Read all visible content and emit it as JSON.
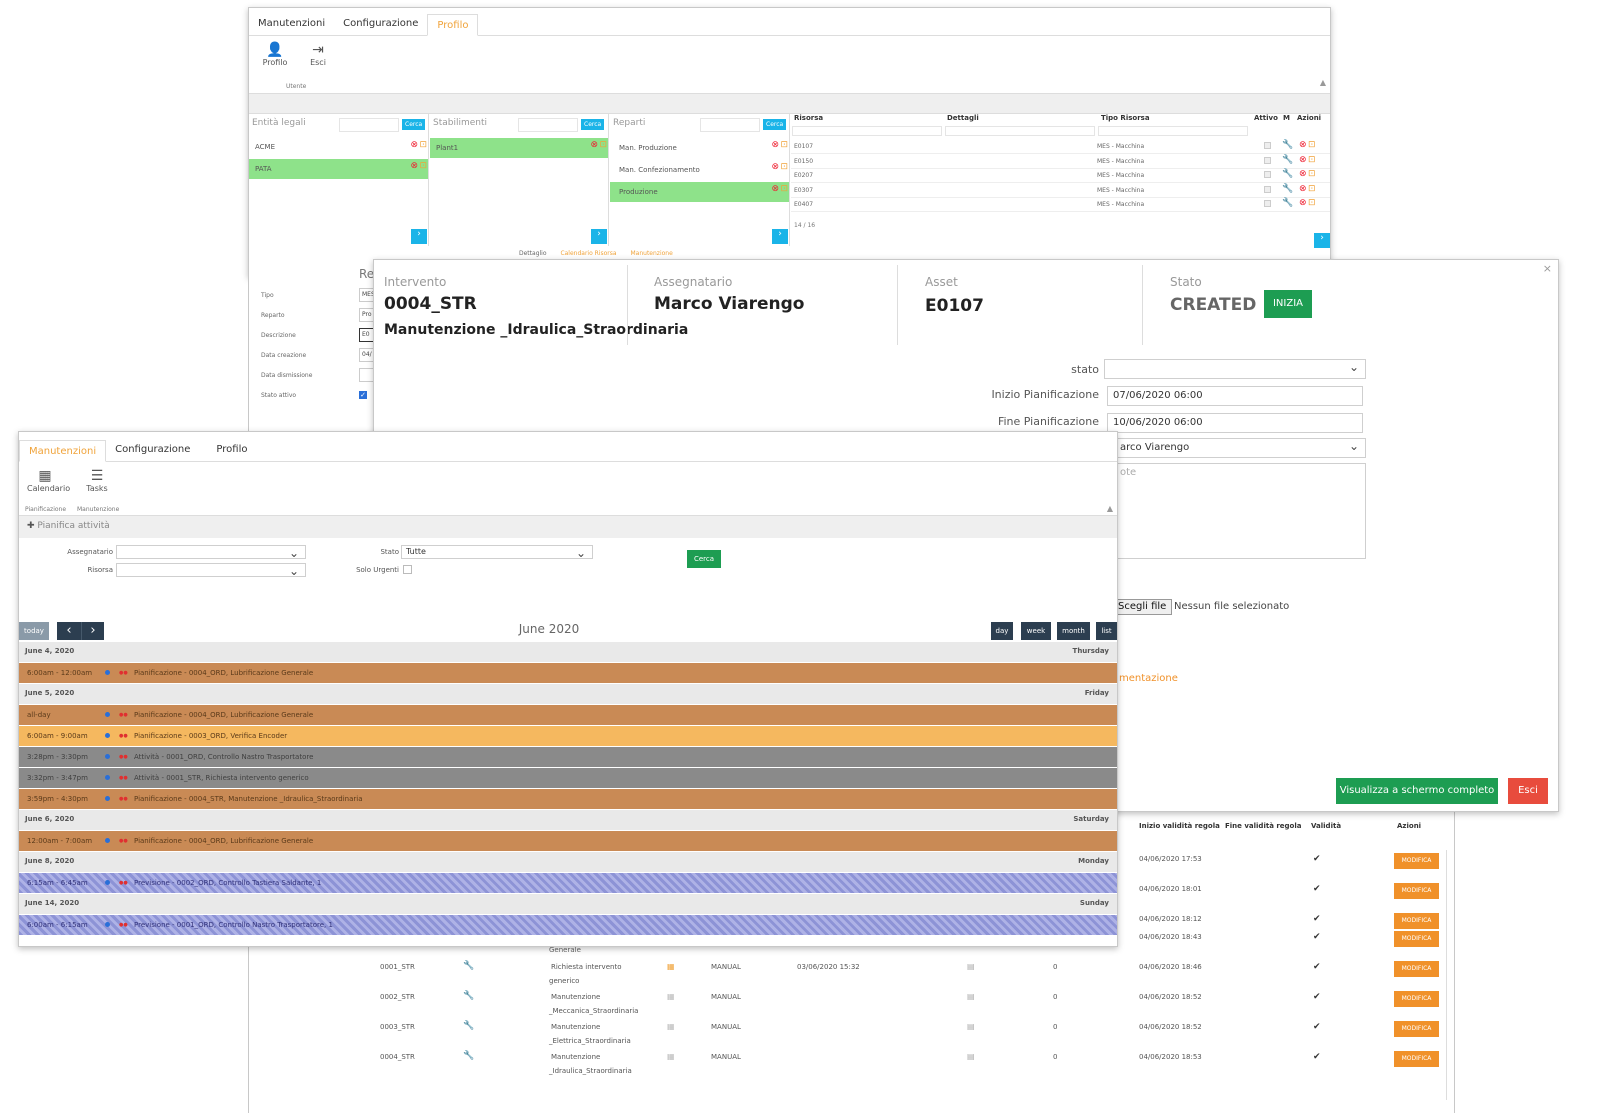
{
  "w1": {
    "menu": [
      "Manutenzioni",
      "Configurazione",
      "Profilo"
    ],
    "ribbon": {
      "profilo": "Profilo",
      "esci": "Esci",
      "group": "Utente"
    },
    "entita": {
      "header": "Entità legali",
      "cerca": "Cerca",
      "rows": [
        "ACME",
        "PATA"
      ]
    },
    "stabilimenti": {
      "header": "Stabilimenti",
      "cerca": "Cerca",
      "rows": [
        "Plant1"
      ]
    },
    "reparti": {
      "header": "Reparti",
      "cerca": "Cerca",
      "rows": [
        "Man. Produzione",
        "Man. Confezionamento",
        "Produzione"
      ]
    },
    "risorse": {
      "headers": [
        "Risorsa",
        "Dettagli",
        "Tipo Risorsa",
        "Attivo",
        "M",
        "Azioni"
      ],
      "rows": [
        {
          "id": "E0107",
          "tipo": "MES - Macchina"
        },
        {
          "id": "E0150",
          "tipo": "MES - Macchina"
        },
        {
          "id": "E0207",
          "tipo": "MES - Macchina"
        },
        {
          "id": "E0307",
          "tipo": "MES - Macchina"
        },
        {
          "id": "E0407",
          "tipo": "MES - Macchina"
        }
      ],
      "count": "14 / 16"
    },
    "detail": {
      "tabs": [
        "Dettaglio",
        "Calendario Risorsa",
        "Manutenzione"
      ],
      "title": "Re",
      "labels": [
        "Tipo",
        "Reparto",
        "Descrizione",
        "Data creazione",
        "Data dismissione",
        "Stato attivo"
      ],
      "values": [
        "MES",
        "Pro",
        "E0",
        "04/",
        "",
        ""
      ]
    }
  },
  "modal": {
    "intervento_label": "Intervento",
    "intervento_code": "0004_STR",
    "intervento_name": "Manutenzione _Idraulica_Straordinaria",
    "assegnatario_label": "Assegnatario",
    "assegnatario_value": "Marco Viarengo",
    "asset_label": "Asset",
    "asset_value": "E0107",
    "stato_label": "Stato",
    "stato_value": "CREATED",
    "inizia": "INIZIA",
    "close": "×",
    "form": {
      "stato_label": "stato",
      "inizio_label": "Inizio Pianificazione",
      "inizio_value": "07/06/2020 06:00",
      "fine_label": "Fine Pianificazione",
      "fine_value": "10/06/2020 06:00",
      "assegnatario_partial": "arco Viarengo",
      "note_partial": "ote",
      "file_button": "Scegli file",
      "file_text": "Nessun file selezionato",
      "link_partial": "mentazione"
    },
    "btn_fullscreen": "Visualizza a schermo completo",
    "btn_esci": "Esci"
  },
  "rules": {
    "headers": [
      "Inizio validità regola",
      "Fine validità regola",
      "Validità",
      "Azioni"
    ],
    "upper_dates": [
      "04/06/2020 17:53",
      "04/06/2020 18:01",
      "04/06/2020 18:12",
      "04/06/2020 18:43"
    ],
    "modifica": "MODIFICA",
    "generale": "Generale",
    "rows": [
      {
        "code": "0001_STR",
        "desc1": "Richiesta intervento",
        "desc2": "generico",
        "type": "MANUAL",
        "planned": "03/06/2020 15:32",
        "count": "0",
        "date": "04/06/2020 18:46"
      },
      {
        "code": "0002_STR",
        "desc1": "Manutenzione",
        "desc2": "_Meccanica_Straordinaria",
        "type": "MANUAL",
        "planned": "",
        "count": "0",
        "date": "04/06/2020 18:52"
      },
      {
        "code": "0003_STR",
        "desc1": "Manutenzione",
        "desc2": "_Elettrica_Straordinaria",
        "type": "MANUAL",
        "planned": "",
        "count": "0",
        "date": "04/06/2020 18:52"
      },
      {
        "code": "0004_STR",
        "desc1": "Manutenzione",
        "desc2": "_Idraulica_Straordinaria",
        "type": "MANUAL",
        "planned": "",
        "count": "0",
        "date": "04/06/2020 18:53"
      }
    ]
  },
  "w3": {
    "menu": [
      "Manutenzioni",
      "Configurazione",
      "Profilo"
    ],
    "ribbon": {
      "calendario": "Calendario",
      "tasks": "Tasks",
      "g1": "Pianificazione",
      "g2": "Manutenzione"
    },
    "pianifica": "Pianifica attività",
    "filters": {
      "assegnatario": "Assegnatario",
      "risorsa": "Risorsa",
      "stato": "Stato",
      "stato_value": "Tutte",
      "urgenti": "Solo Urgenti",
      "cerca": "Cerca"
    },
    "nav": {
      "today": "today",
      "prev": "‹",
      "next": "›",
      "title": "June 2020",
      "views": [
        "day",
        "week",
        "month",
        "list"
      ]
    },
    "days": [
      {
        "date": "June 4, 2020",
        "dow": "Thursday",
        "events": [
          {
            "time": "6:00am - 12:00am",
            "title": "Pianificazione - 0004_ORD, Lubrificazione Generale",
            "kind": "brown"
          }
        ]
      },
      {
        "date": "June 5, 2020",
        "dow": "Friday",
        "events": [
          {
            "time": "all-day",
            "title": "Pianificazione - 0004_ORD, Lubrificazione Generale",
            "kind": "brown"
          },
          {
            "time": "6:00am - 9:00am",
            "title": "Pianificazione - 0003_ORD, Verifica Encoder",
            "kind": "amber"
          },
          {
            "time": "3:28pm - 3:30pm",
            "title": "Attività - 0001_ORD, Controllo Nastro Trasportatore",
            "kind": "gray"
          },
          {
            "time": "3:32pm - 3:47pm",
            "title": "Attività - 0001_STR, Richiesta intervento generico",
            "kind": "gray"
          },
          {
            "time": "3:59pm - 4:30pm",
            "title": "Pianificazione - 0004_STR, Manutenzione _Idraulica_Straordinaria",
            "kind": "brown"
          }
        ]
      },
      {
        "date": "June 6, 2020",
        "dow": "Saturday",
        "events": [
          {
            "time": "12:00am - 7:00am",
            "title": "Pianificazione - 0004_ORD, Lubrificazione Generale",
            "kind": "brown"
          }
        ]
      },
      {
        "date": "June 8, 2020",
        "dow": "Monday",
        "events": [
          {
            "time": "6:15am - 6:45am",
            "title": "Previsione - 0002_ORD, Controllo Tastiera Saldante, 1",
            "kind": "stripe"
          }
        ]
      },
      {
        "date": "June 14, 2020",
        "dow": "Sunday",
        "events": [
          {
            "time": "6:00am - 6:15am",
            "title": "Previsione - 0001_ORD, Controllo Nastro Trasportatore, 1",
            "kind": "stripe"
          }
        ]
      }
    ]
  },
  "colors": {
    "brown": "#c98a55",
    "amber": "#f5b85f",
    "gray": "#8a8a8a",
    "green": "#1d9d52",
    "orange": "#f0912a",
    "red": "#e84c3d"
  }
}
